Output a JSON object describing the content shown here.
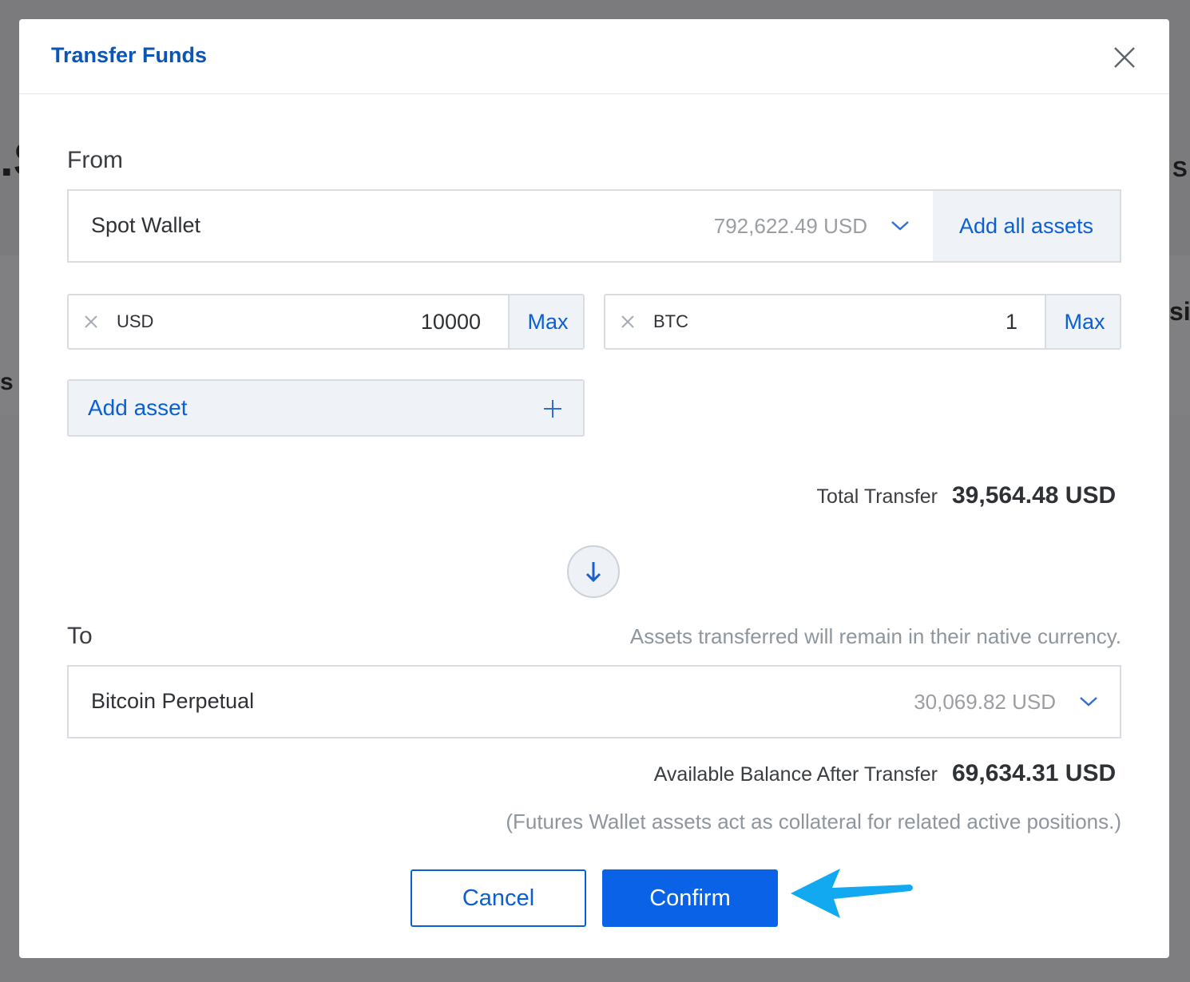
{
  "background": {
    "fragments": [
      ".S",
      "s",
      "S",
      "sis",
      "s"
    ]
  },
  "dialog": {
    "title": "Transfer Funds"
  },
  "from": {
    "label": "From",
    "wallet_name": "Spot Wallet",
    "wallet_balance": "792,622.49 USD",
    "add_all_label": "Add all assets",
    "assets": [
      {
        "code": "USD",
        "amount": "10000",
        "max_label": "Max"
      },
      {
        "code": "BTC",
        "amount": "1",
        "max_label": "Max"
      }
    ],
    "add_asset_label": "Add asset",
    "total_label": "Total Transfer",
    "total_value": "39,564.48 USD"
  },
  "to": {
    "label": "To",
    "note": "Assets transferred will remain in their native currency.",
    "wallet_name": "Bitcoin Perpetual",
    "wallet_balance": "30,069.82 USD",
    "balance_after_label": "Available Balance After Transfer",
    "balance_after_value": "69,634.31 USD",
    "collateral_note": "(Futures Wallet assets act as collateral for related active positions.)"
  },
  "actions": {
    "cancel_label": "Cancel",
    "confirm_label": "Confirm"
  },
  "colors": {
    "accent": "#0A63E6",
    "title": "#0B55B5",
    "callout_arrow": "#12A9F0"
  }
}
